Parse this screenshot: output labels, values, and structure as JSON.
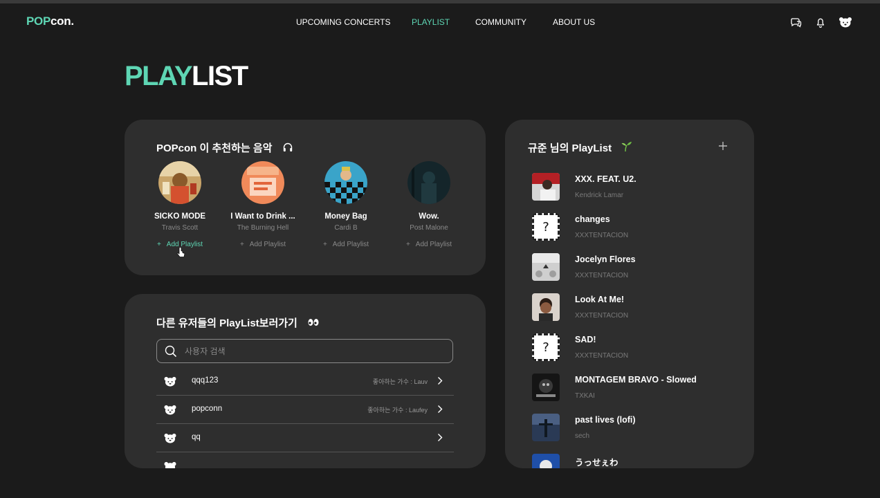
{
  "header": {
    "logo_pop": "POP",
    "logo_con": "con.",
    "nav": [
      {
        "label": "UPCOMING CONCERTS"
      },
      {
        "label": "PLAYLIST"
      },
      {
        "label": "COMMUNITY"
      },
      {
        "label": "ABOUT US"
      }
    ],
    "icons": [
      "chat-icon",
      "bell-icon",
      "profile-avatar-icon"
    ]
  },
  "page": {
    "title_part1": "PLAY",
    "title_part2": "LIST"
  },
  "recommend": {
    "title": "POPcon 이 추천하는 음악",
    "icon": "headphones-icon",
    "items": [
      {
        "song": "SICKO MODE",
        "artist": "Travis Scott",
        "add_label": "Add Playlist"
      },
      {
        "song": "I Want to Drink ...",
        "artist": "The Burning Hell",
        "add_label": "Add Playlist"
      },
      {
        "song": "Money Bag",
        "artist": "Cardi B",
        "add_label": "Add Playlist"
      },
      {
        "song": "Wow.",
        "artist": "Post Malone",
        "add_label": "Add Playlist"
      }
    ]
  },
  "others": {
    "title": "다른 유저들의 PlayList보러가기",
    "icon": "eyes-icon",
    "search_placeholder": "사용자 검색",
    "users": [
      {
        "name": "qqq123",
        "fav": "좋아하는 가수 : Lauv"
      },
      {
        "name": "popconn",
        "fav": "좋아하는 가수 : Laufey"
      },
      {
        "name": "qq",
        "fav": ""
      }
    ]
  },
  "my_playlist": {
    "title": "규준 님의 PlayList",
    "icon": "sprout-icon",
    "tracks": [
      {
        "title": "XXX. FEAT. U2.",
        "artist": "Kendrick Lamar"
      },
      {
        "title": "changes",
        "artist": "XXXTENTACION"
      },
      {
        "title": "Jocelyn Flores",
        "artist": "XXXTENTACION"
      },
      {
        "title": "Look At Me!",
        "artist": "XXXTENTACION"
      },
      {
        "title": "SAD!",
        "artist": "XXXTENTACION"
      },
      {
        "title": "MONTAGEM BRAVO - Slowed",
        "artist": "TXKAI"
      },
      {
        "title": "past lives (lofi)",
        "artist": "sech"
      },
      {
        "title": "うっせぇわ",
        "artist": ""
      }
    ]
  },
  "colors": {
    "accent": "#5ed6b4",
    "background": "#1b1b1b",
    "card": "#2e2e2e"
  }
}
